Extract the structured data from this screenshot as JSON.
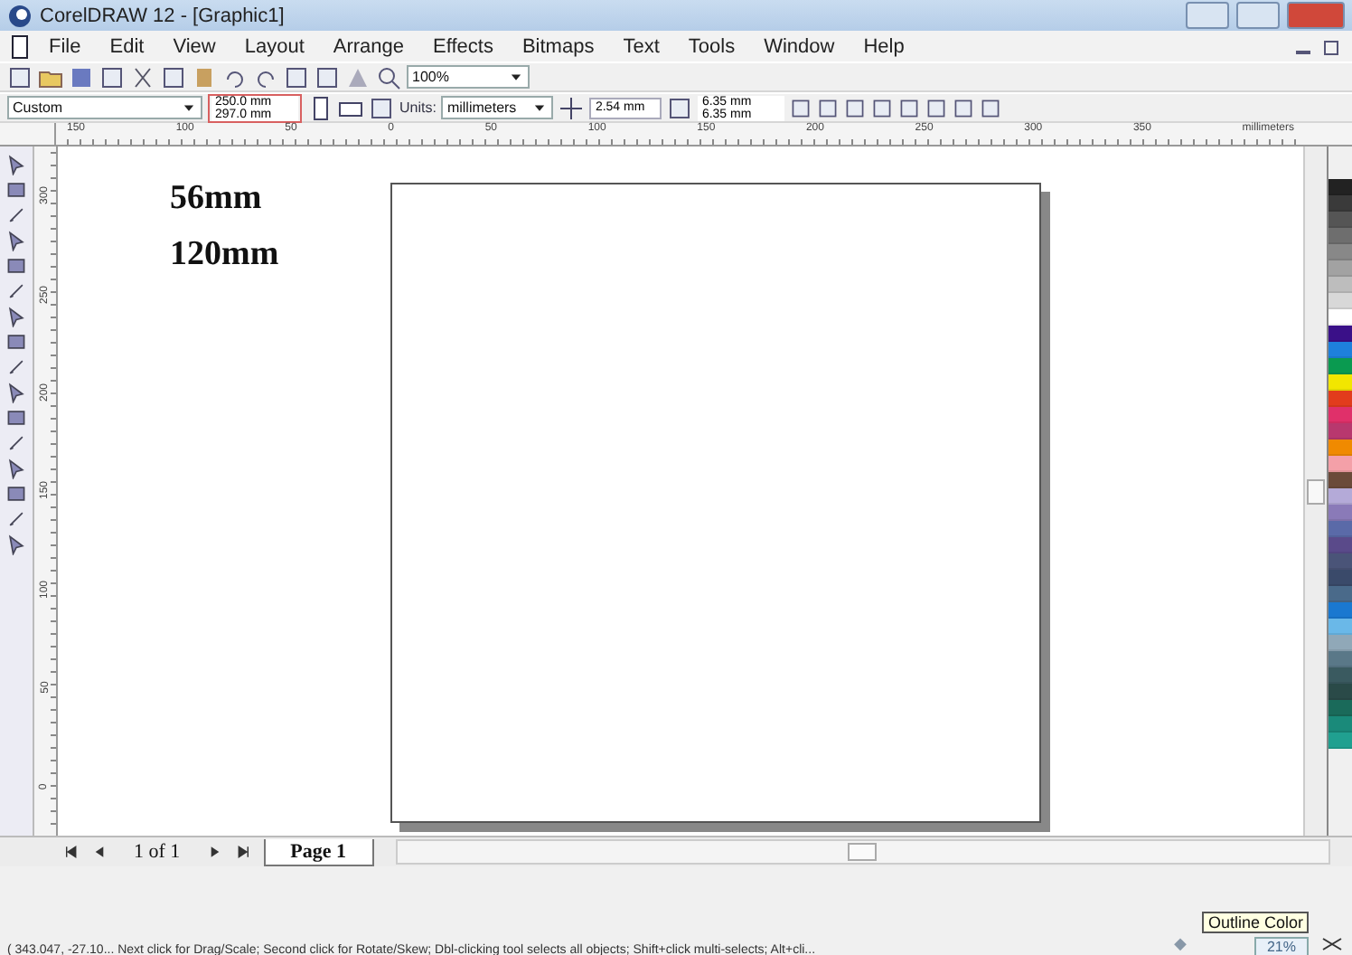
{
  "window": {
    "title": "CorelDRAW 12 - [Graphic1]"
  },
  "menu": [
    "File",
    "Edit",
    "View",
    "Layout",
    "Arrange",
    "Effects",
    "Bitmaps",
    "Text",
    "Tools",
    "Window",
    "Help"
  ],
  "standard_toolbar": {
    "zoom": "100%"
  },
  "property_bar": {
    "paper": "Custom",
    "width": "250.0 mm",
    "height": "297.0 mm",
    "units_label": "Units:",
    "units": "millimeters",
    "nudge": "2.54 mm",
    "duplicate_x": "6.35 mm",
    "duplicate_y": "6.35 mm"
  },
  "ruler": {
    "labels": [
      "150",
      "100",
      "50",
      "0",
      "50",
      "100",
      "150",
      "200",
      "250",
      "300",
      "350"
    ],
    "unit": "millimeters"
  },
  "vertical_ruler": {
    "labels": [
      "300",
      "250",
      "200",
      "150",
      "100",
      "50",
      "0"
    ]
  },
  "canvas": {
    "texts": [
      "56mm",
      "120mm"
    ]
  },
  "page_nav": {
    "count": "1 of 1",
    "tabs": [
      {
        "label": "Page 1",
        "selected": true
      }
    ]
  },
  "palette": [
    {
      "color": "#222222"
    },
    {
      "color": "#3a3a3a"
    },
    {
      "color": "#555555"
    },
    {
      "color": "#6e6e6e"
    },
    {
      "color": "#888888"
    },
    {
      "color": "#a2a2a2"
    },
    {
      "color": "#bdbdbd"
    },
    {
      "color": "#d8d8d8"
    },
    {
      "color": "#ffffff"
    },
    {
      "color": "#3a1088"
    },
    {
      "color": "#1e80dc"
    },
    {
      "color": "#0a9a50"
    },
    {
      "color": "#f2e600"
    },
    {
      "color": "#e23c1c"
    },
    {
      "color": "#e0306a"
    },
    {
      "color": "#b8386e"
    },
    {
      "color": "#f08a00"
    },
    {
      "color": "#f4a0a8"
    },
    {
      "color": "#6a4a3a"
    },
    {
      "color": "#b4aad8"
    },
    {
      "color": "#8a7ab8"
    },
    {
      "color": "#5a6aa8"
    },
    {
      "color": "#5a4a8a"
    },
    {
      "color": "#4a5478"
    },
    {
      "color": "#3a4a6a"
    },
    {
      "color": "#4a6a8a"
    },
    {
      "color": "#1a78d0"
    },
    {
      "color": "#6ab8e8"
    },
    {
      "color": "#90a8b8"
    },
    {
      "color": "#5a7888"
    },
    {
      "color": "#3a5a60"
    },
    {
      "color": "#2a4a48"
    },
    {
      "color": "#1a6a5a"
    },
    {
      "color": "#1a8a7a"
    },
    {
      "color": "#20a090"
    }
  ],
  "status_bar": {
    "message": "( 343.047, -27.10... Next click for Drag/Scale; Second click for Rotate/Skew; Dbl-clicking tool selects all objects; Shift+click multi-selects; Alt+cli...",
    "tooltip": "Outline Color",
    "zoom": "21%"
  }
}
